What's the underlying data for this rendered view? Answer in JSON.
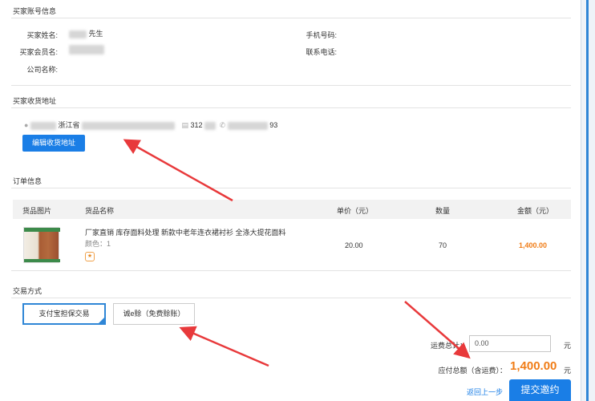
{
  "buyer_info": {
    "title": "买家账号信息",
    "name_label": "买家姓名:",
    "name_suffix": "先生",
    "member_label": "买家会员名:",
    "company_label": "公司名称:",
    "mobile_label": "手机号码:",
    "phone_label": "联系电话:"
  },
  "address": {
    "title": "买家收货地址",
    "province_prefix": "浙江省",
    "zip_partial": "312",
    "phone_partial": "93",
    "edit_button": "编辑收货地址"
  },
  "order": {
    "title": "订单信息",
    "columns": [
      "货品图片",
      "货品名称",
      "单价（元）",
      "数量",
      "金额（元）"
    ],
    "item": {
      "name": "厂家直销 库存面料处理 新款中老年连衣裙衬衫 全涤大提花面料",
      "color_label": "颜色：1",
      "price": "20.00",
      "quantity": "70",
      "amount": "1,400.00"
    }
  },
  "payment": {
    "title": "交易方式",
    "options": [
      "支付宝担保交易",
      "诚e赊（免费赊账）"
    ]
  },
  "footer": {
    "shipping_label": "运费总计：",
    "shipping_value": "0.00",
    "yuan": "元",
    "total_label": "应付总额（含运费）：",
    "total_value": "1,400.00",
    "back_link": "返回上一步",
    "submit_button": "提交邀约"
  },
  "colors": {
    "accent_blue": "#1a7ee6",
    "price_orange": "#f07c16",
    "annotation_red": "#e8393b"
  }
}
